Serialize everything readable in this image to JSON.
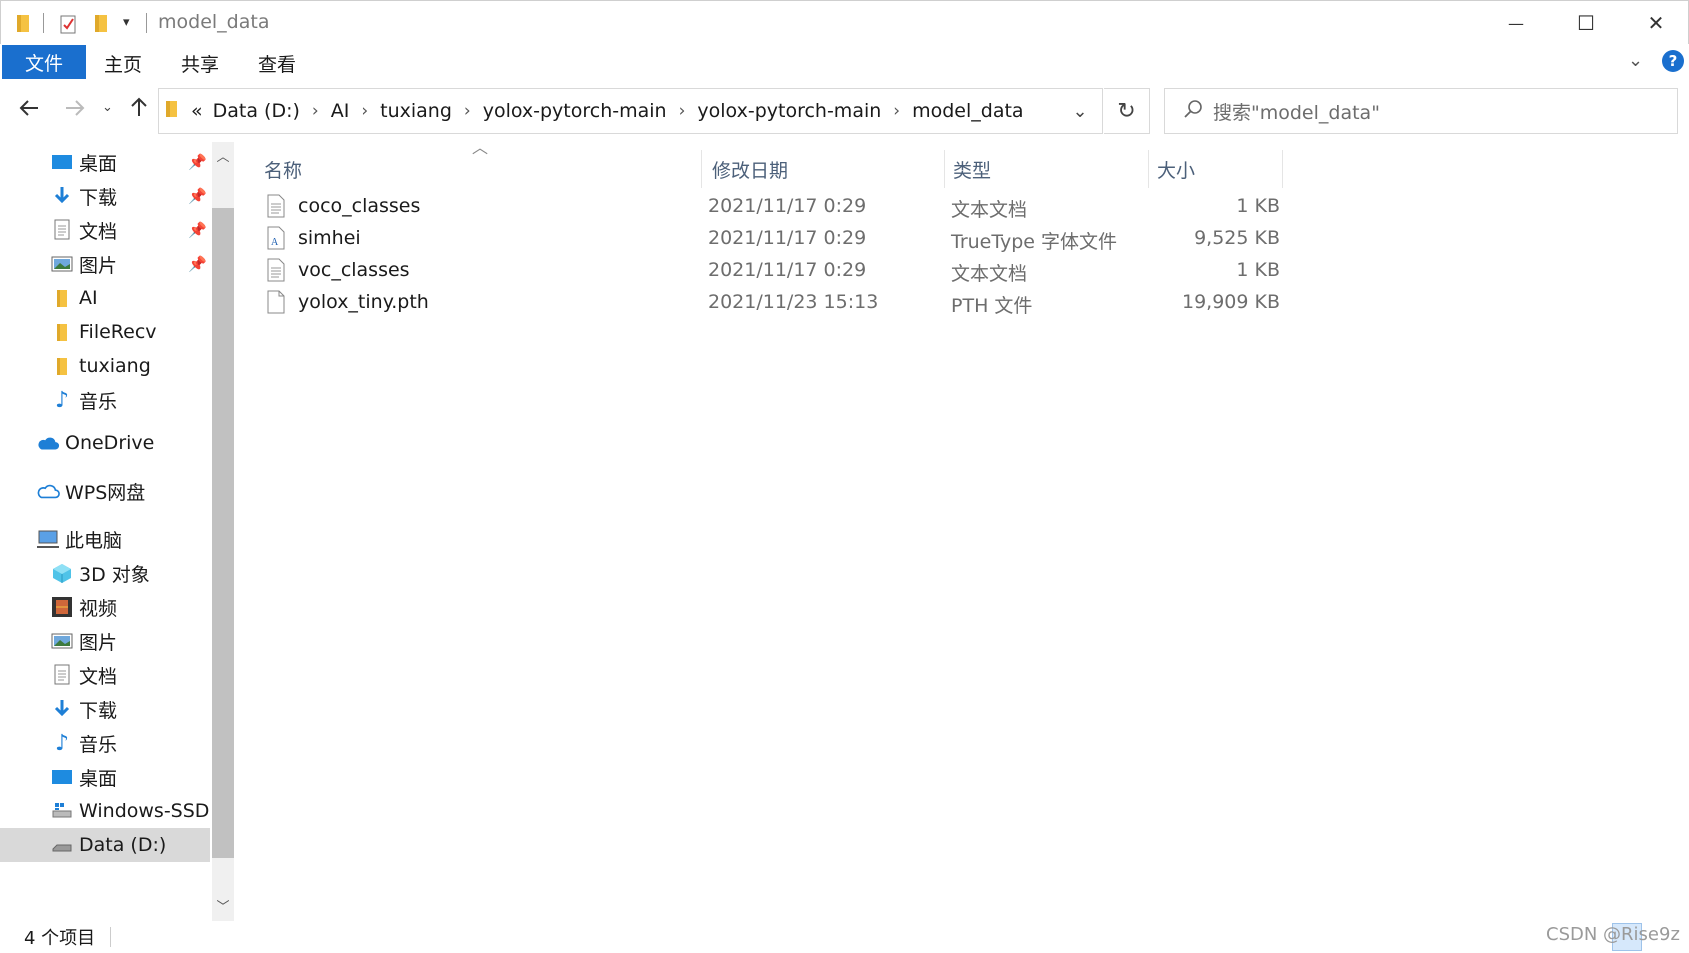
{
  "window": {
    "title": "model_data",
    "minimize": "—",
    "maximize": "☐",
    "close": "✕"
  },
  "ribbon": {
    "tabs": [
      "文件",
      "主页",
      "共享",
      "查看"
    ]
  },
  "address": {
    "overflow": "«",
    "crumbs": [
      "Data (D:)",
      "AI",
      "tuxiang",
      "yolox-pytorch-main",
      "yolox-pytorch-main",
      "model_data"
    ],
    "separator": "›"
  },
  "search": {
    "placeholder": "搜索\"model_data\""
  },
  "nav": {
    "quick_access": [
      {
        "label": "桌面",
        "icon": "desktop-icon",
        "pinned": true
      },
      {
        "label": "下载",
        "icon": "download-icon",
        "pinned": true
      },
      {
        "label": "文档",
        "icon": "document-icon",
        "pinned": true
      },
      {
        "label": "图片",
        "icon": "picture-icon",
        "pinned": true
      },
      {
        "label": "AI",
        "icon": "folder-icon",
        "pinned": false
      },
      {
        "label": "FileRecv",
        "icon": "folder-icon",
        "pinned": false
      },
      {
        "label": "tuxiang",
        "icon": "folder-icon",
        "pinned": false
      },
      {
        "label": "音乐",
        "icon": "music-icon",
        "pinned": false
      }
    ],
    "onedrive": "OneDrive",
    "wps": "WPS网盘",
    "this_pc": "此电脑",
    "pc_items": [
      {
        "label": "3D 对象",
        "icon": "3d-objects-icon"
      },
      {
        "label": "视频",
        "icon": "video-icon"
      },
      {
        "label": "图片",
        "icon": "picture-icon"
      },
      {
        "label": "文档",
        "icon": "document-icon"
      },
      {
        "label": "下载",
        "icon": "download-icon"
      },
      {
        "label": "音乐",
        "icon": "music-icon"
      },
      {
        "label": "桌面",
        "icon": "desktop-icon"
      },
      {
        "label": "Windows-SSD (",
        "icon": "drive-icon"
      },
      {
        "label": "Data (D:)",
        "icon": "drive-icon"
      }
    ]
  },
  "columns": {
    "name": "名称",
    "modified": "修改日期",
    "type": "类型",
    "size": "大小"
  },
  "files": [
    {
      "name": "coco_classes",
      "modified": "2021/11/17 0:29",
      "type": "文本文档",
      "size": "1 KB",
      "icon": "text-file-icon"
    },
    {
      "name": "simhei",
      "modified": "2021/11/17 0:29",
      "type": "TrueType 字体文件",
      "size": "9,525 KB",
      "icon": "font-file-icon"
    },
    {
      "name": "voc_classes",
      "modified": "2021/11/17 0:29",
      "type": "文本文档",
      "size": "1 KB",
      "icon": "text-file-icon"
    },
    {
      "name": "yolox_tiny.pth",
      "modified": "2021/11/23 15:13",
      "type": "PTH 文件",
      "size": "19,909 KB",
      "icon": "blank-file-icon"
    }
  ],
  "status": {
    "count": "4 个项目",
    "watermark": "CSDN @Rise9z"
  }
}
